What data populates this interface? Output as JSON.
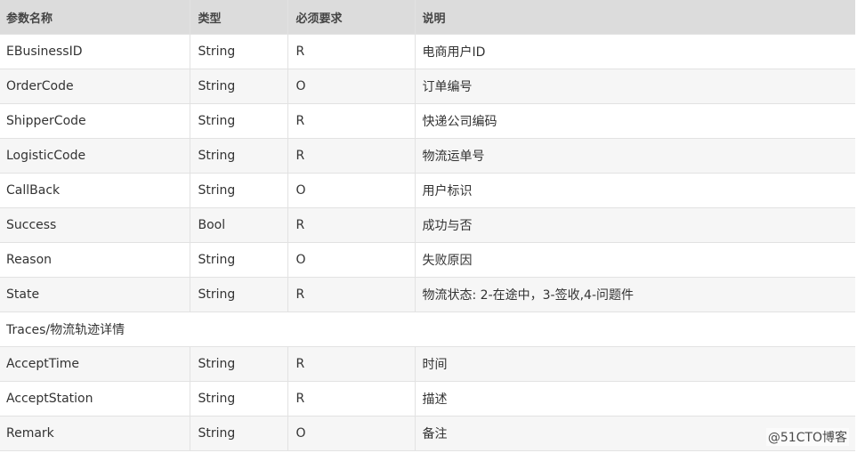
{
  "table": {
    "headers": [
      "参数名称",
      "类型",
      "必须要求",
      "说明"
    ],
    "rows_before": [
      [
        "EBusinessID",
        "String",
        "R",
        "电商用户ID"
      ],
      [
        "OrderCode",
        "String",
        "O",
        "订单编号"
      ],
      [
        "ShipperCode",
        "String",
        "R",
        "快递公司编码"
      ],
      [
        "LogisticCode",
        "String",
        "R",
        "物流运单号"
      ],
      [
        "CallBack",
        "String",
        "O",
        "用户标识"
      ],
      [
        "Success",
        "Bool",
        "R",
        "成功与否"
      ],
      [
        "Reason",
        "String",
        "O",
        "失败原因"
      ],
      [
        "State",
        "String",
        "R",
        "物流状态: 2-在途中，3-签收,4-问题件"
      ]
    ],
    "section_label": "Traces/物流轨迹详情",
    "rows_after": [
      [
        "AcceptTime",
        "String",
        "R",
        "时间"
      ],
      [
        "AcceptStation",
        "String",
        "R",
        "描述"
      ],
      [
        "Remark",
        "String",
        "O",
        "备注"
      ]
    ]
  },
  "watermark": "@51CTO博客"
}
